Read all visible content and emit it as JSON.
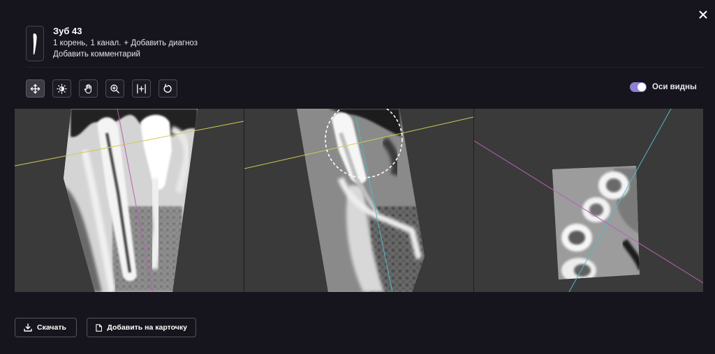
{
  "tooth": {
    "title": "Зуб 43",
    "roots": "1 корень,",
    "canals": "1 канал.",
    "add_diagnosis": "+ Добавить диагноз",
    "add_comment": "Добавить комментарий"
  },
  "toolbar": {
    "tools": [
      {
        "name": "move-tool",
        "icon": "move-arrows-icon",
        "active": true
      },
      {
        "name": "brightness-tool",
        "icon": "brightness-icon",
        "active": false
      },
      {
        "name": "pan-tool",
        "icon": "hand-icon",
        "active": false
      },
      {
        "name": "zoom-tool",
        "icon": "zoom-in-icon",
        "active": false
      },
      {
        "name": "measure-tool",
        "icon": "ruler-icon",
        "active": false
      },
      {
        "name": "rotate-tool",
        "icon": "rotate-icon",
        "active": false
      }
    ]
  },
  "axes_toggle": {
    "label": "Оси видны",
    "on": true,
    "color": "#8d80d6"
  },
  "viewer": {
    "axis_colors": {
      "yellow": "#cfcc55",
      "magenta": "#b85fb5",
      "cyan": "#4fb9c4"
    }
  },
  "actions": {
    "download": "Скачать",
    "add_to_card": "Добавить на карточку"
  }
}
